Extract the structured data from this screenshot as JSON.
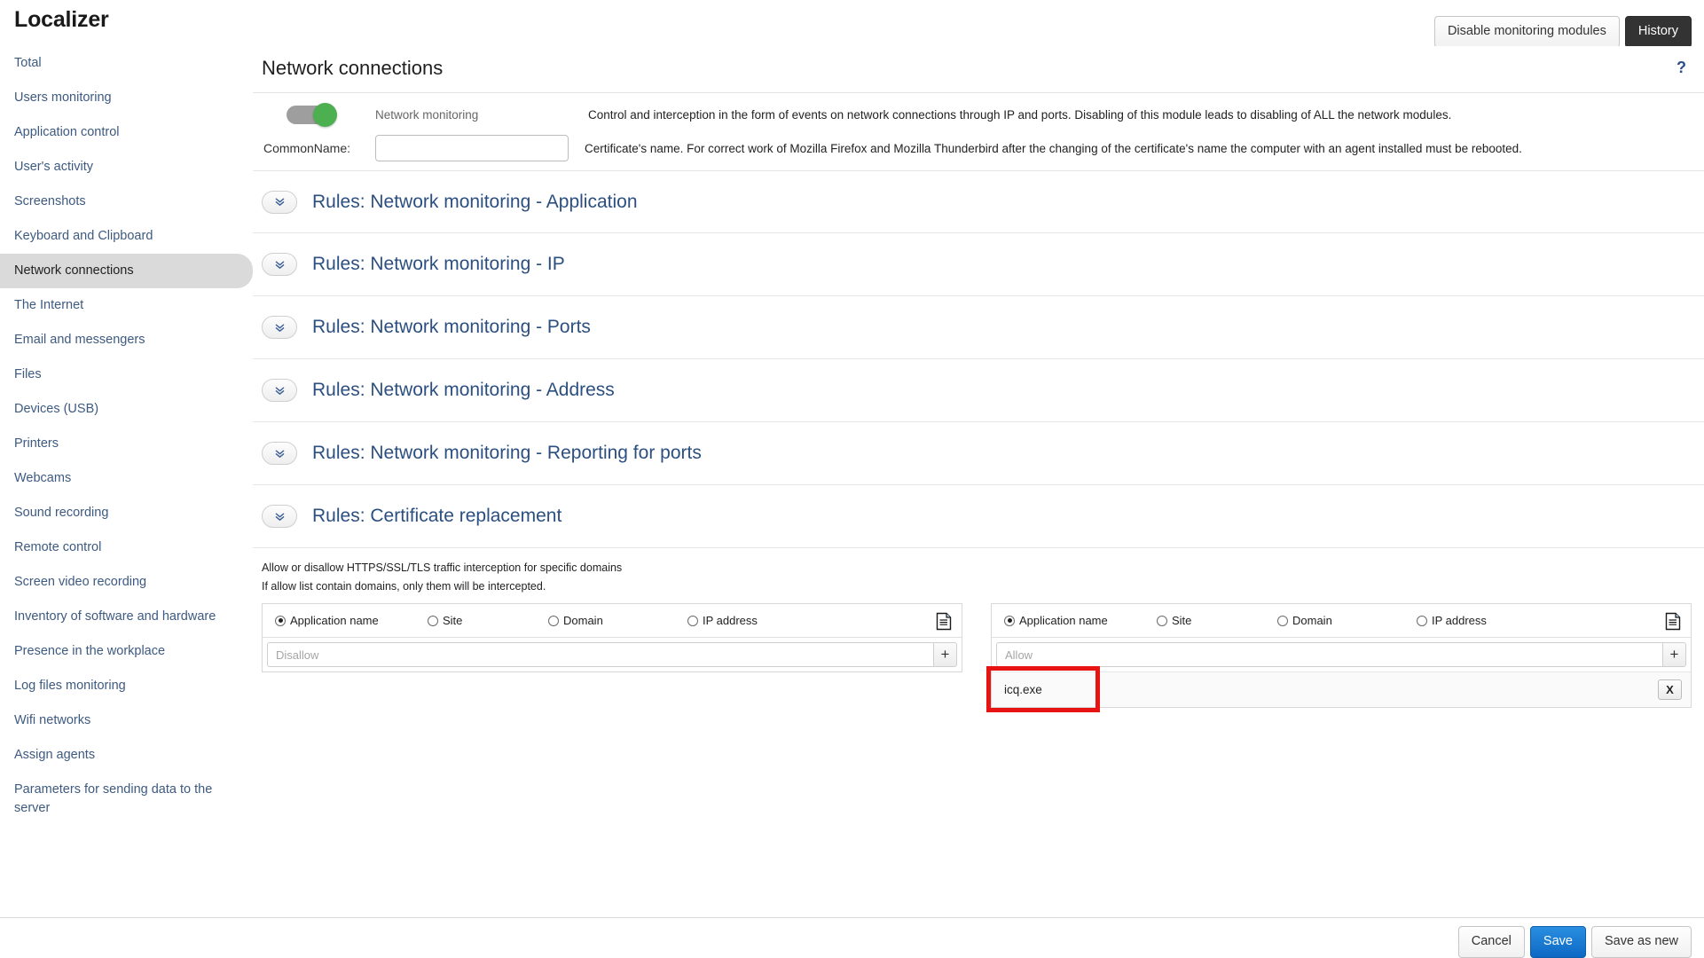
{
  "app": {
    "brand": "Localizer"
  },
  "topbar": {
    "disable_modules_label": "Disable monitoring modules",
    "history_label": "History"
  },
  "sidebar": {
    "items": [
      {
        "label": "Total",
        "active": false
      },
      {
        "label": "Users monitoring",
        "active": false
      },
      {
        "label": "Application control",
        "active": false
      },
      {
        "label": "User's activity",
        "active": false
      },
      {
        "label": "Screenshots",
        "active": false
      },
      {
        "label": "Keyboard and Clipboard",
        "active": false
      },
      {
        "label": "Network connections",
        "active": true
      },
      {
        "label": "The Internet",
        "active": false
      },
      {
        "label": "Email and messengers",
        "active": false
      },
      {
        "label": "Files",
        "active": false
      },
      {
        "label": "Devices (USB)",
        "active": false
      },
      {
        "label": "Printers",
        "active": false
      },
      {
        "label": "Webcams",
        "active": false
      },
      {
        "label": "Sound recording",
        "active": false
      },
      {
        "label": "Remote control",
        "active": false
      },
      {
        "label": "Screen video recording",
        "active": false
      },
      {
        "label": "Inventory of software and hardware",
        "active": false
      },
      {
        "label": "Presence in the workplace",
        "active": false
      },
      {
        "label": "Log files monitoring",
        "active": false
      },
      {
        "label": "Wifi networks",
        "active": false
      },
      {
        "label": "Assign agents",
        "active": false
      },
      {
        "label": "Parameters for sending data to the server",
        "active": false
      }
    ]
  },
  "main": {
    "page_title": "Network connections",
    "help_glyph": "?",
    "monitoring": {
      "toggle_on": true,
      "label": "Network monitoring",
      "description": "Control and interception in the form of events on network connections through IP and ports. Disabling of this module leads to disabling of ALL the network modules."
    },
    "common_name": {
      "label": "CommonName:",
      "value": "",
      "placeholder": "",
      "description": "Certificate's name. For correct work of Mozilla Firefox and Mozilla Thunderbird after the changing of the certificate's name the computer with an agent installed must be rebooted."
    },
    "sections": [
      {
        "title": "Rules: Network monitoring - Application",
        "expanded": false
      },
      {
        "title": "Rules: Network monitoring - IP",
        "expanded": false
      },
      {
        "title": "Rules: Network monitoring - Ports",
        "expanded": false
      },
      {
        "title": "Rules: Network monitoring - Address",
        "expanded": false
      },
      {
        "title": "Rules: Network monitoring - Reporting for ports",
        "expanded": false
      },
      {
        "title": "Rules: Certificate replacement",
        "expanded": true
      }
    ],
    "certificate_replacement": {
      "hint_line_1": "Allow or disallow HTTPS/SSL/TLS traffic interception for specific domains",
      "hint_line_2": "If allow list contain domains, only them will be intercepted.",
      "filter_options": [
        "Application name",
        "Site",
        "Domain",
        "IP address"
      ],
      "disallow_panel": {
        "selected_option": "Application name",
        "input_placeholder": "Disallow",
        "input_value": "",
        "add_label": "+",
        "entries": []
      },
      "allow_panel": {
        "selected_option": "Application name",
        "input_placeholder": "Allow",
        "input_value": "",
        "add_label": "+",
        "entries": [
          {
            "name": "icq.exe",
            "delete_label": "X",
            "highlighted": true
          }
        ]
      }
    }
  },
  "bottombar": {
    "cancel_label": "Cancel",
    "save_label": "Save",
    "save_as_new_label": "Save as new"
  },
  "colors": {
    "accent_link": "#2b4f80",
    "toggle_on": "#4caf50",
    "primary_button": "#0d68c4",
    "highlight": "#e81313",
    "sidebar_active": "#dadada"
  }
}
